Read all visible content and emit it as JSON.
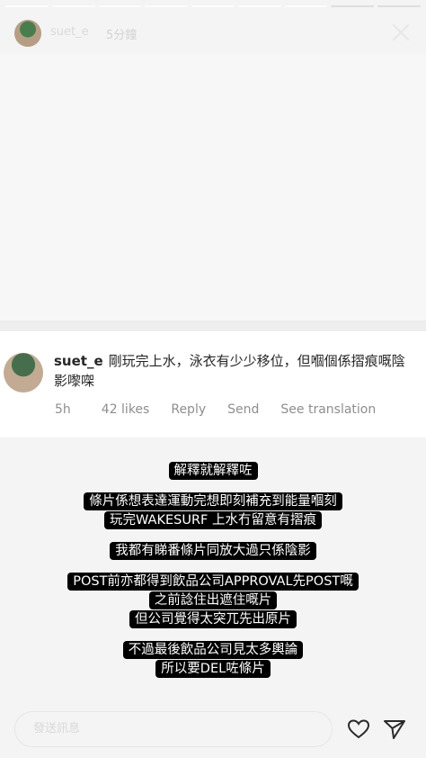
{
  "story": {
    "username": "suet_e",
    "time_ago": "5分鐘",
    "segments": 9
  },
  "comment": {
    "username": "suet_e",
    "text": "剛玩完上水，泳衣有少少移位，但嗰個係摺痕嘅陰影嚟㗎",
    "time": "5h",
    "likes": "42 likes",
    "reply_label": "Reply",
    "send_label": "Send",
    "translate_label": "See translation"
  },
  "captions": [
    [
      "解釋就解釋咗"
    ],
    [
      "條片係想表達運動完想即刻補充到能量嗰刻",
      "玩完WAKESURF 上水冇留意有摺痕"
    ],
    [
      "我都有睇番條片同放大過只係陰影"
    ],
    [
      "POST前亦都得到飲品公司APPROVAL先POST嘅",
      "之前諗住出遮住嘅片",
      "但公司覺得太突兀先出原片"
    ],
    [
      "不過最後飲品公司見太多輿論",
      "所以要DEL咗條片"
    ]
  ],
  "reply": {
    "placeholder": "發送訊息"
  }
}
